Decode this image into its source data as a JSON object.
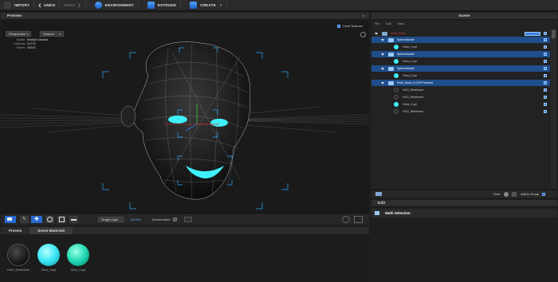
{
  "toolbar": {
    "import": "IMPORT",
    "undo": "UNDO",
    "redo": "REDO",
    "environment": "ENVIRONMENT",
    "extrude": "EXTRUDE",
    "create": "CREATE"
  },
  "preview": {
    "title": "Preview",
    "draft_textures": "Draft Textures",
    "view_mode": "Perspective",
    "shade_mode": "Shaded",
    "stats": {
      "model_label": "Model:",
      "model_value": "Multiple Models",
      "vertices_label": "Vertices:",
      "vertices_value": "31776",
      "faces_label": "Faces:",
      "faces_value": "15002"
    }
  },
  "viewport_bar": {
    "light_mode": "Single Light",
    "zoom": "100.0%",
    "environment": "Environment"
  },
  "scene": {
    "title": "Scene",
    "menu": [
      "File",
      "Edit",
      "View"
    ],
    "rows": [
      {
        "label": "Kwiri_Head",
        "type": "root",
        "selected": false
      },
      {
        "label": "SphereModel",
        "type": "model",
        "selected": true
      },
      {
        "label": "Glow_Copt",
        "type": "material",
        "selected": false
      },
      {
        "label": "SphereModel",
        "type": "model",
        "selected": true
      },
      {
        "label": "Glow_Copt",
        "type": "material",
        "selected": false
      },
      {
        "label": "SphereModel",
        "type": "model",
        "selected": true
      },
      {
        "label": "Glow_Copt",
        "type": "material",
        "selected": false
      },
      {
        "label": "Kwiri_Head_0 (109 Frames)",
        "type": "model",
        "selected": true
      },
      {
        "label": "HUD_Wireframe",
        "type": "material-dark",
        "selected": false
      },
      {
        "label": "HUD_Wireframe",
        "type": "material-dark",
        "selected": false
      },
      {
        "label": "Glow_Copt",
        "type": "material",
        "selected": false
      },
      {
        "label": "HUD_Wireframe",
        "type": "material-dark",
        "selected": false
      }
    ],
    "footer": {
      "view_label": "View:",
      "add_to_group": "Add to Group"
    }
  },
  "edit": {
    "title": "Edit",
    "selection": "Multi Selection"
  },
  "presets": {
    "tabs": [
      "Presets",
      "Scene Materials"
    ],
    "materials": [
      {
        "label": "HUD_Wireframe",
        "color": "dark"
      },
      {
        "label": "Glow_Copt",
        "color": "cyan"
      },
      {
        "label": "Glow_Copt",
        "color": "teal"
      }
    ]
  },
  "colors": {
    "accent_blue": "#1f4e8c",
    "glow_cyan": "#3ff0ff",
    "root_red": "#e04040"
  }
}
